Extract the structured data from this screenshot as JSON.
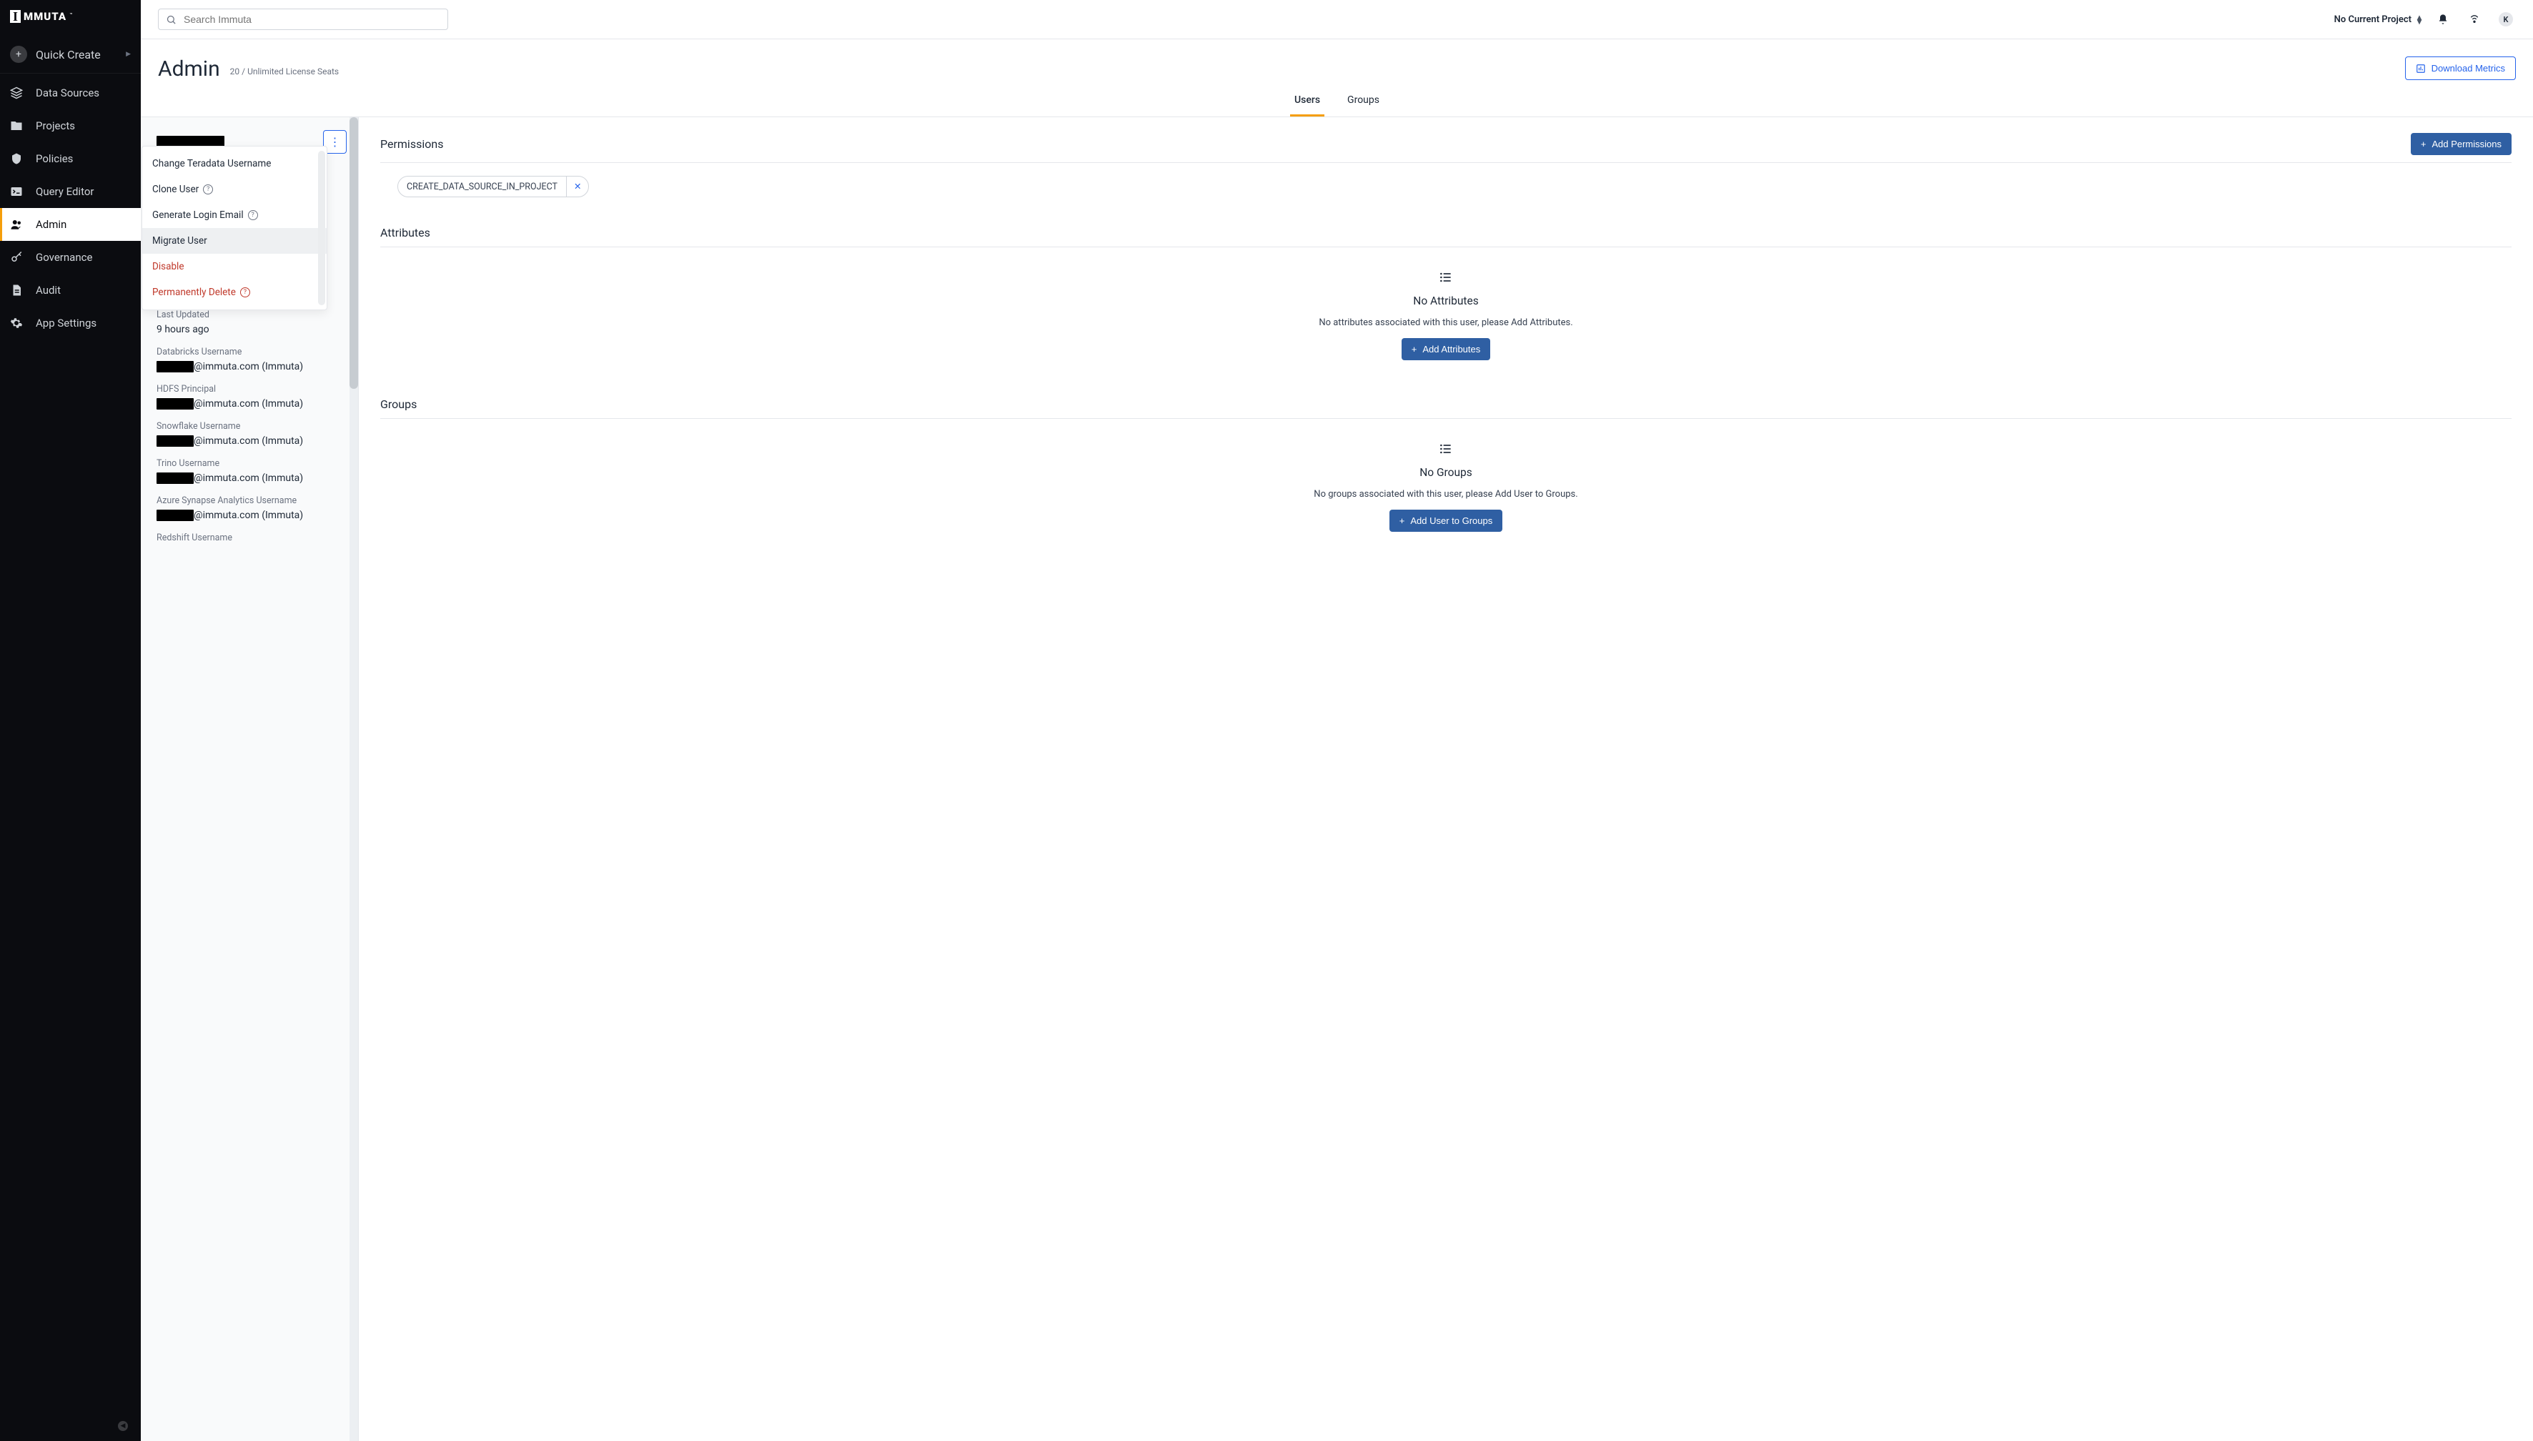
{
  "brand": {
    "mark": "I",
    "name": "MMUTA",
    "tm": "™"
  },
  "quick_create": {
    "label": "Quick Create"
  },
  "nav": {
    "items": [
      {
        "icon": "layers-icon",
        "label": "Data Sources"
      },
      {
        "icon": "folder-icon",
        "label": "Projects"
      },
      {
        "icon": "shield-icon",
        "label": "Policies"
      },
      {
        "icon": "terminal-icon",
        "label": "Query Editor"
      },
      {
        "icon": "people-icon",
        "label": "Admin",
        "active": true
      },
      {
        "icon": "key-icon",
        "label": "Governance"
      },
      {
        "icon": "doc-icon",
        "label": "Audit"
      },
      {
        "icon": "gear-icon",
        "label": "App Settings"
      }
    ]
  },
  "search": {
    "placeholder": "Search Immuta"
  },
  "topbar": {
    "project": "No Current Project",
    "avatar": "K"
  },
  "page": {
    "title": "Admin",
    "license": "20 / Unlimited License Seats",
    "download": "Download Metrics"
  },
  "tabs": {
    "users": "Users",
    "groups": "Groups"
  },
  "menu": {
    "change_teradata": "Change Teradata Username",
    "clone": "Clone User",
    "gen_email": "Generate Login Email",
    "migrate": "Migrate User",
    "disable": "Disable",
    "perm_delete": "Permanently Delete"
  },
  "user": {
    "fields": {
      "last_updated_label": "Last Updated",
      "last_updated_value": "9 hours ago",
      "databricks_label": "Databricks Username",
      "hdfs_label": "HDFS Principal",
      "snowflake_label": "Snowflake Username",
      "trino_label": "Trino Username",
      "synapse_label": "Azure Synapse Analytics Username",
      "redshift_label": "Redshift Username",
      "suffix": "@immuta.com (Immuta)"
    }
  },
  "permissions": {
    "title": "Permissions",
    "add": "Add Permissions",
    "chips": [
      "CREATE_DATA_SOURCE_IN_PROJECT"
    ]
  },
  "attributes": {
    "title": "Attributes",
    "empty_title": "No Attributes",
    "empty_text": "No attributes associated with this user, please Add Attributes.",
    "add": "Add Attributes"
  },
  "groups": {
    "title": "Groups",
    "empty_title": "No Groups",
    "empty_text": "No groups associated with this user, please Add User to Groups.",
    "add": "Add User to Groups"
  }
}
